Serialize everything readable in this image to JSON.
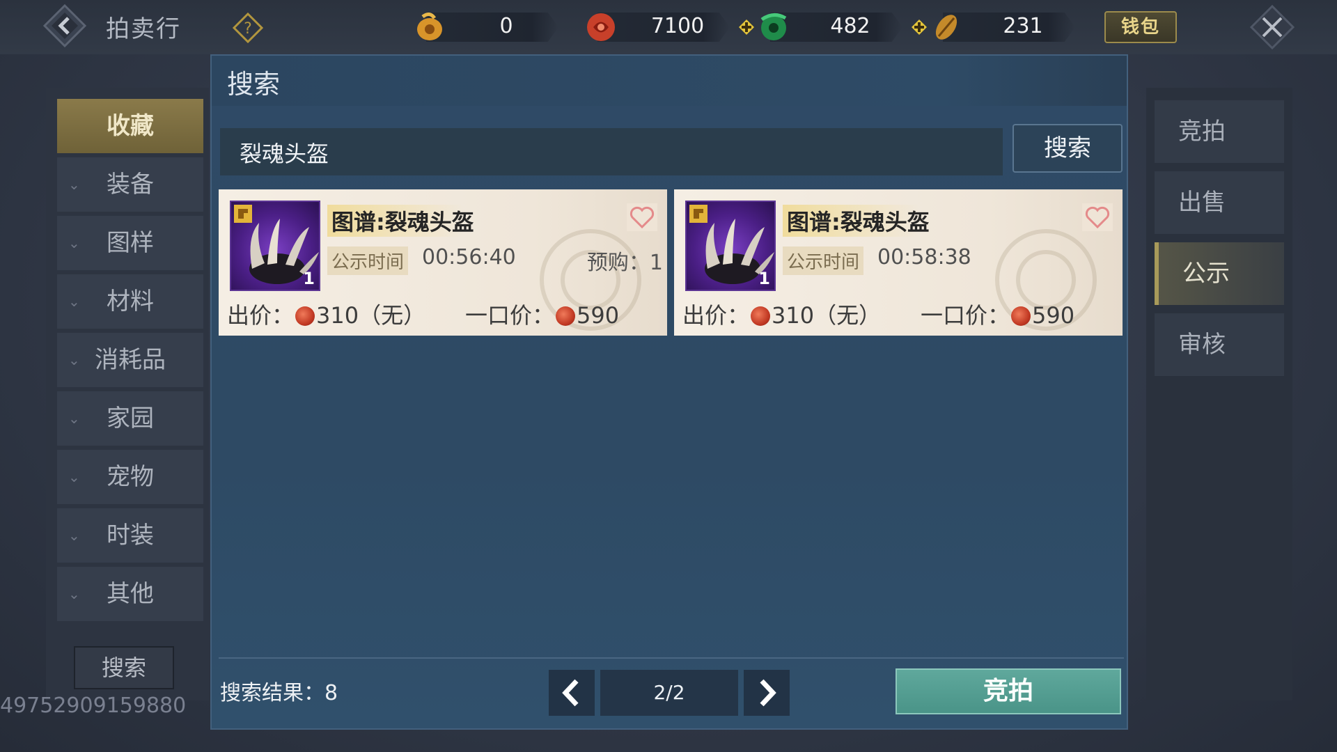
{
  "header": {
    "title": "拍卖行",
    "wallet_label": "钱包",
    "currencies": [
      {
        "name": "gold-coin",
        "value": "0",
        "color": "#d99a2b"
      },
      {
        "name": "red-jade",
        "value": "7100",
        "color": "#c8402a"
      },
      {
        "name": "green-jade",
        "value": "482",
        "color": "#2aa35a"
      },
      {
        "name": "shell",
        "value": "231",
        "color": "#b8862a"
      }
    ]
  },
  "categories": [
    {
      "label": "收藏",
      "active": true
    },
    {
      "label": "装备"
    },
    {
      "label": "图样"
    },
    {
      "label": "材料"
    },
    {
      "label": "消耗品"
    },
    {
      "label": "家园"
    },
    {
      "label": "宠物"
    },
    {
      "label": "时装"
    },
    {
      "label": "其他"
    }
  ],
  "left_search_label": "搜索",
  "uid": "49752909159880",
  "right_tabs": [
    {
      "label": "竞拍"
    },
    {
      "label": "出售"
    },
    {
      "label": "公示",
      "active": true
    },
    {
      "label": "审核"
    }
  ],
  "panel": {
    "title": "搜索",
    "search_value": "裂魂头盔",
    "search_button": "搜索",
    "items": [
      {
        "name": "图谱:裂魂头盔",
        "qty": "1",
        "time_label": "公示时间",
        "time_value": "00:56:40",
        "prebuy": "预购：1",
        "bid_label": "出价：",
        "bid_value": "310（无）",
        "buyout_label": "一口价：",
        "buyout_value": "590"
      },
      {
        "name": "图谱:裂魂头盔",
        "qty": "1",
        "time_label": "公示时间",
        "time_value": "00:58:38",
        "prebuy": "",
        "bid_label": "出价：",
        "bid_value": "310（无）",
        "buyout_label": "一口价：",
        "buyout_value": "590"
      }
    ],
    "result_label": "搜索结果：8",
    "page": "2/2",
    "bid_button": "竞拍"
  }
}
